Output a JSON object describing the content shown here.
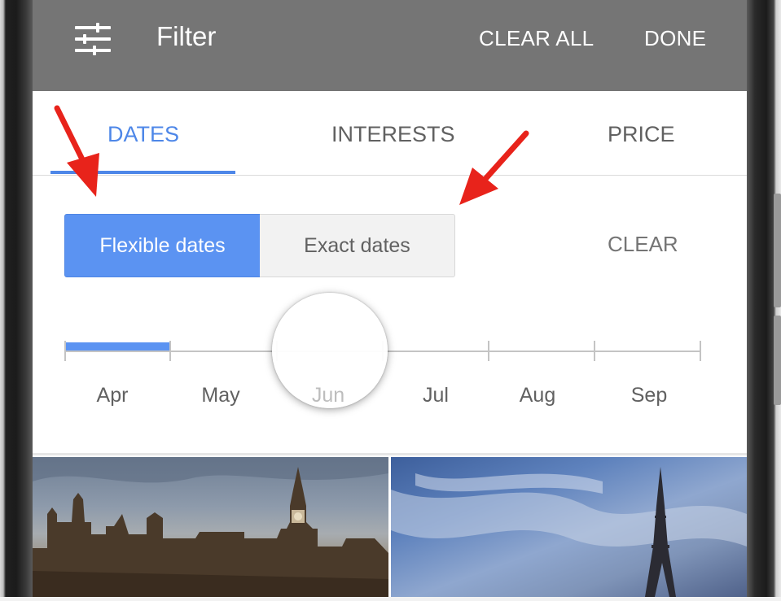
{
  "toolbar": {
    "title": "Filter",
    "clear_all_label": "CLEAR ALL",
    "done_label": "DONE",
    "icon": "tune-sliders-icon"
  },
  "tabs": [
    {
      "label": "DATES",
      "active": true
    },
    {
      "label": "INTERESTS",
      "active": false
    },
    {
      "label": "PRICE",
      "active": false
    }
  ],
  "date_mode": {
    "flexible_label": "Flexible dates",
    "exact_label": "Exact dates",
    "selected": "Flexible dates"
  },
  "clear_label": "CLEAR",
  "month_slider": {
    "months": [
      "Apr",
      "May",
      "Jun",
      "Jul",
      "Aug",
      "Sep"
    ],
    "selected_range": [
      "Apr",
      "May"
    ],
    "hovered": "Jun"
  },
  "photos": [
    {
      "icon": "london-big-ben-photo"
    },
    {
      "icon": "paris-eiffel-tower-photo"
    }
  ],
  "colors": {
    "accent": "#5b93f2",
    "toolbar": "#757575",
    "annotation": "#e8231b"
  }
}
